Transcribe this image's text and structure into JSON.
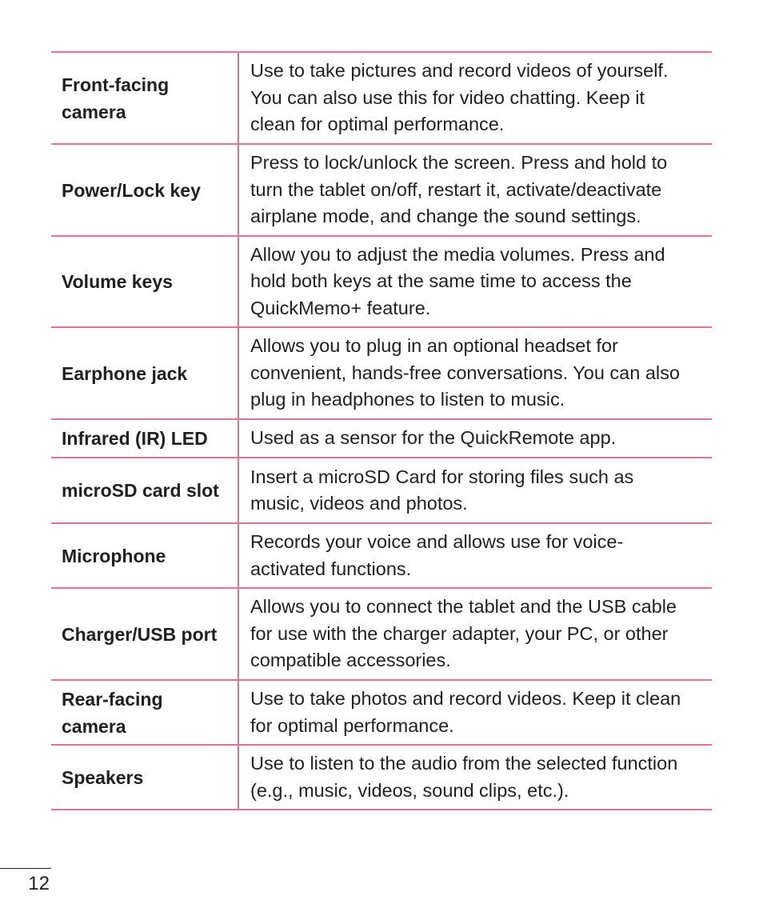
{
  "page_number": "12",
  "colors": {
    "rule": "#d9778f",
    "text": "#231f20"
  },
  "rows": [
    {
      "term": [
        "Front-facing",
        "camera"
      ],
      "desc": [
        "Use to take pictures and record videos of yourself.",
        "You can also use this for video chatting. Keep it",
        "clean for optimal performance."
      ]
    },
    {
      "term": [
        "Power/Lock key"
      ],
      "desc": [
        "Press to lock/unlock the screen. Press and hold to",
        "turn the tablet on/off, restart it, activate/deactivate",
        "airplane mode, and change the sound settings."
      ]
    },
    {
      "term": [
        "Volume keys"
      ],
      "desc": [
        "Allow you to adjust the media volumes. Press and",
        "hold both keys at the same time to access the",
        "QuickMemo+ feature."
      ]
    },
    {
      "term": [
        "Earphone jack"
      ],
      "desc": [
        "Allows you to plug in an optional headset for",
        "convenient, hands-free conversations. You can also",
        "plug in headphones to listen to music."
      ]
    },
    {
      "term": [
        "Infrared (IR) LED"
      ],
      "desc": [
        "Used as a sensor for the QuickRemote app."
      ]
    },
    {
      "term": [
        "microSD card slot"
      ],
      "desc": [
        "Insert a microSD Card for storing files such as",
        "music, videos and photos."
      ]
    },
    {
      "term": [
        "Microphone"
      ],
      "desc": [
        "Records your voice and allows use for voice-",
        "activated functions."
      ]
    },
    {
      "term": [
        "Charger/USB port"
      ],
      "desc": [
        "Allows you to connect the tablet and the USB cable",
        "for use with the charger adapter, your PC, or other",
        "compatible accessories."
      ]
    },
    {
      "term": [
        "Rear-facing",
        "camera"
      ],
      "desc": [
        "Use to take photos and record videos. Keep it clean",
        "for optimal performance."
      ]
    },
    {
      "term": [
        "Speakers"
      ],
      "desc": [
        "Use to listen to the audio from the selected function",
        "(e.g., music, videos, sound clips, etc.)."
      ]
    }
  ]
}
